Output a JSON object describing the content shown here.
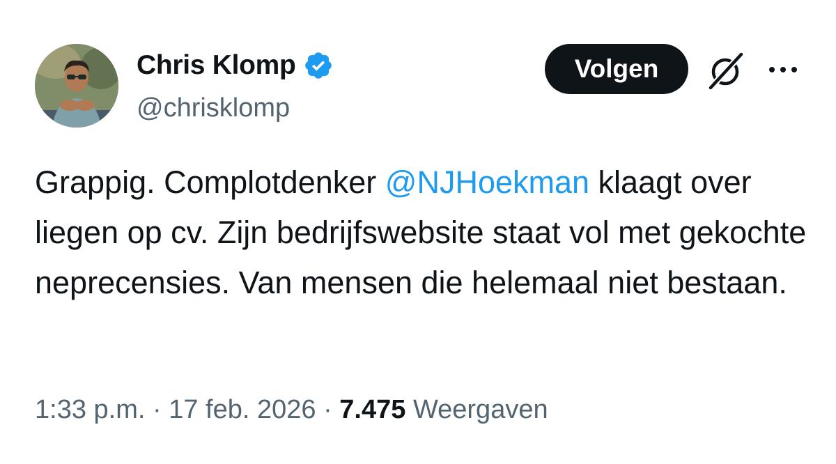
{
  "author": {
    "display_name": "Chris Klomp",
    "handle": "@chrisklomp",
    "verified": true,
    "verified_color": "#1d9bf0"
  },
  "actions": {
    "follow_label": "Volgen",
    "grok_icon": "grok-icon",
    "more_icon": "more-horizontal-icon"
  },
  "tweet": {
    "text_before": "Grappig. Complotdenker ",
    "mention": "@NJHoekman",
    "text_after": " klaagt over liegen op cv. Zijn bedrijfswebsite staat vol met gekochte neprecensies. Van mensen die helemaal niet bestaan."
  },
  "meta": {
    "time": "1:33 p.m.",
    "separator": "·",
    "date": "17 feb. 2026",
    "views_count": "7.475",
    "views_label": "Weergaven"
  },
  "colors": {
    "text": "#0f1419",
    "secondary": "#536471",
    "link": "#1d9bf0",
    "button_bg": "#0f1419"
  }
}
